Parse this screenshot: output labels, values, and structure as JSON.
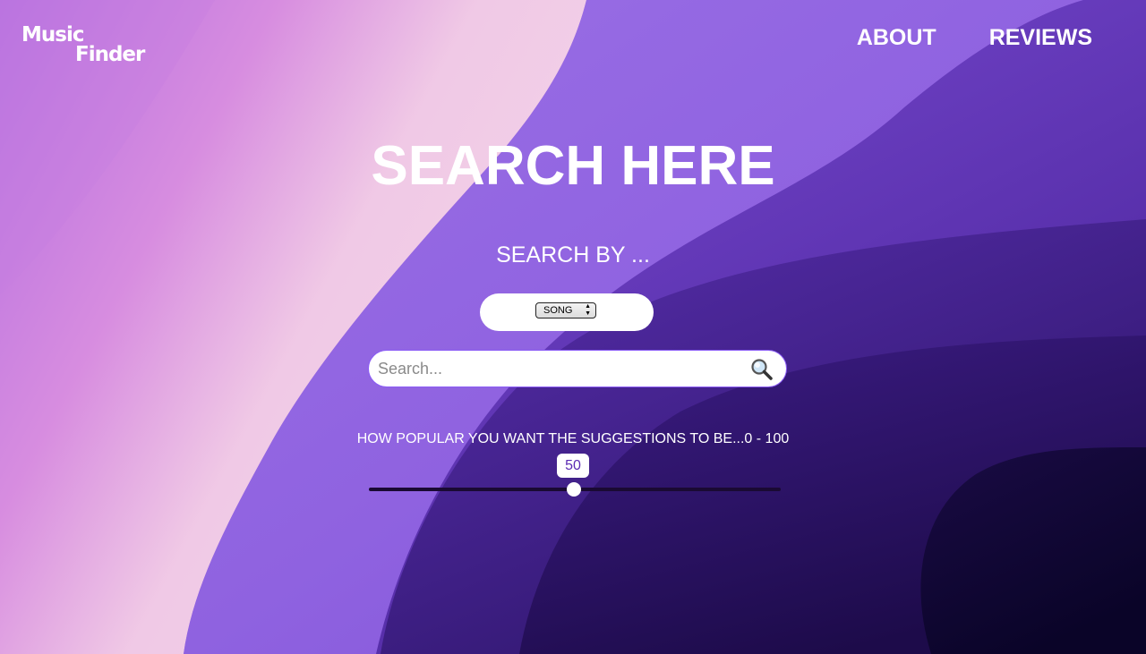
{
  "brand": {
    "line1": "Music",
    "line2": "Finder"
  },
  "nav": {
    "items": [
      {
        "label": "ABOUT"
      },
      {
        "label": "REVIEWS"
      }
    ]
  },
  "main": {
    "title": "SEARCH HERE",
    "search_by_label": "SEARCH BY ...",
    "search_by_select": {
      "selected": "SONG"
    },
    "search": {
      "placeholder": "Search...",
      "value": "",
      "icon": "magnifier-icon"
    },
    "popularity": {
      "label": "HOW POPULAR YOU WANT THE SUGGESTIONS TO BE...0 - 100",
      "min": 0,
      "max": 100,
      "value": "50"
    }
  },
  "colors": {
    "background_light": "#f1c8e8",
    "background_mid": "#8c5fe0",
    "background_dark": "#2a1560",
    "background_darkest": "#0d0630",
    "slider_value_text": "#5b2bb3"
  }
}
